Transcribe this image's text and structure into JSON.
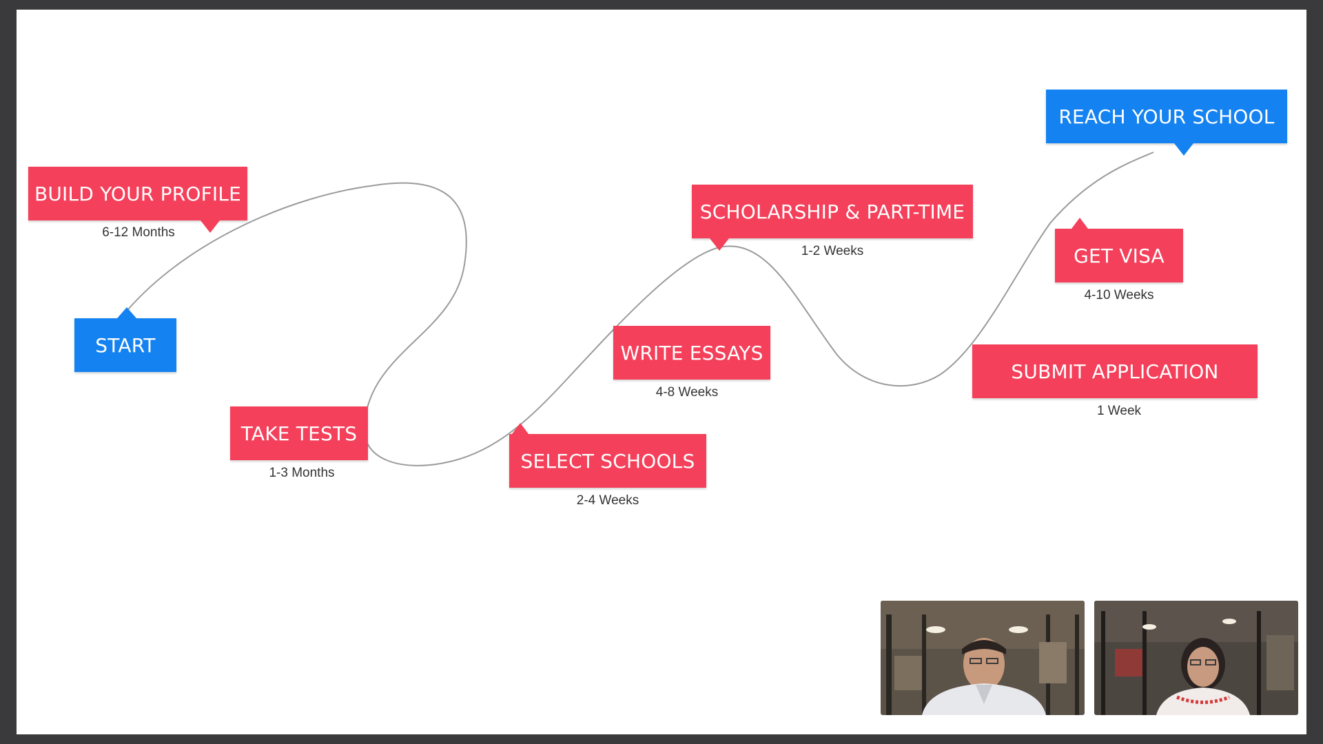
{
  "roadmap": {
    "start": "START",
    "build_profile": {
      "label": "BUILD YOUR PROFILE",
      "duration": "6-12 Months"
    },
    "take_tests": {
      "label": "TAKE TESTS",
      "duration": "1-3 Months"
    },
    "select_schools": {
      "label": "SELECT SCHOOLS",
      "duration": "2-4 Weeks"
    },
    "write_essays": {
      "label": "WRITE ESSAYS",
      "duration": "4-8 Weeks"
    },
    "scholarship": {
      "label": "SCHOLARSHIP & PART-TIME",
      "duration": "1-2 Weeks"
    },
    "submit_application": {
      "label": "SUBMIT APPLICATION",
      "duration": "1 Week"
    },
    "get_visa": {
      "label": "GET VISA",
      "duration": "4-10 Weeks"
    },
    "reach_school": "REACH YOUR SCHOOL"
  },
  "colors": {
    "step_red": "#f4405a",
    "step_blue": "#1482f0",
    "path_line": "#9a9a9a",
    "frame": "#3a3a3c"
  },
  "participants": [
    {
      "icon": "participant-video-male"
    },
    {
      "icon": "participant-video-female"
    }
  ]
}
